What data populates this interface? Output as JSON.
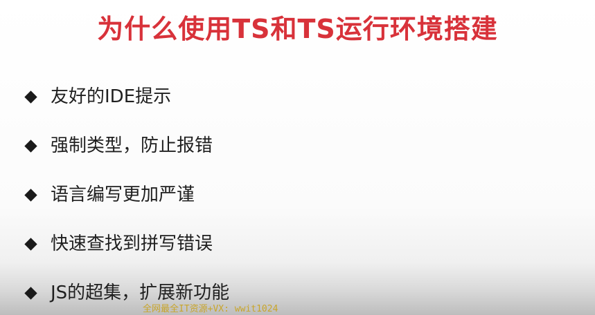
{
  "slide": {
    "title": "为什么使用TS和TS运行环境搭建",
    "title_color": "#d8323a",
    "bullet_icon": "diamond-bullet-icon",
    "bullets": [
      "友好的IDE提示",
      "强制类型，防止报错",
      "语言编写更加严谨",
      "快速查找到拼写错误",
      "JS的超集，扩展新功能"
    ]
  },
  "watermark": {
    "text": "全网最全IT资源+VX: wwit1024",
    "color": "#c9a21a"
  }
}
